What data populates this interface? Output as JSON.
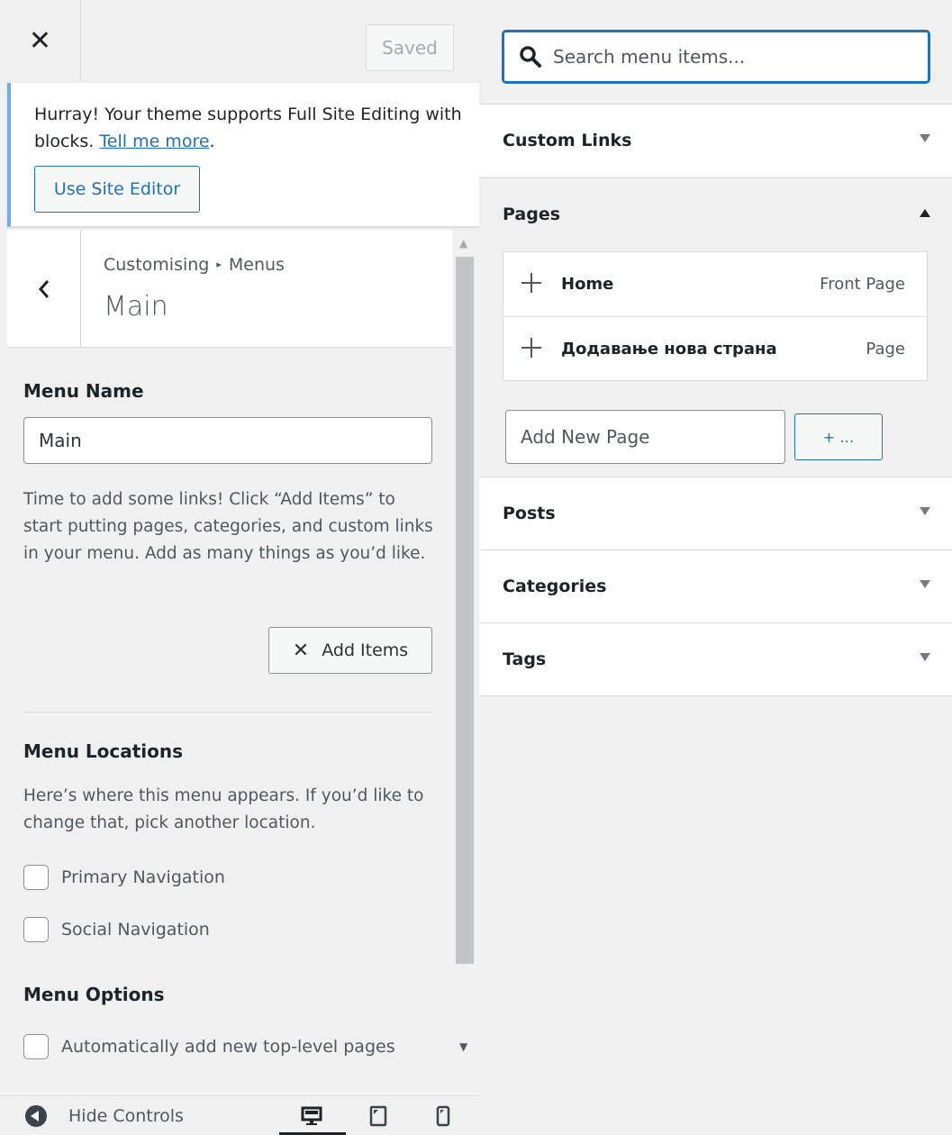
{
  "header": {
    "close_label": "✕",
    "saved_label": "Saved"
  },
  "notice": {
    "text_before": "Hurray! Your theme supports Full Site Editing with blocks.",
    "link_text": "Tell me more",
    "text_after": ".",
    "button_label": "Use Site Editor"
  },
  "section": {
    "breadcrumb_root": "Customising",
    "breadcrumb_separator": "▸",
    "breadcrumb_current": "Menus",
    "title": "Main"
  },
  "menu": {
    "name_label": "Menu Name",
    "name_value": "Main",
    "help_text": "Time to add some links! Click “Add Items” to start putting pages, categories, and custom links in your menu. Add as many things as you’d like.",
    "add_items_label": "Add Items",
    "locations_label": "Menu Locations",
    "locations_desc": "Here’s where this menu appears. If you’d like to change that, pick another location.",
    "locations": [
      {
        "label": "Primary Navigation",
        "checked": false
      },
      {
        "label": "Social Navigation",
        "checked": false
      }
    ],
    "options_label": "Menu Options",
    "options": [
      {
        "label": "Automatically add new top-level pages",
        "checked": false
      }
    ]
  },
  "footer": {
    "hide_controls_label": "Hide Controls",
    "active_device": "desktop",
    "devices": [
      "desktop",
      "tablet",
      "mobile"
    ]
  },
  "items_panel": {
    "search_placeholder": "Search menu items...",
    "sections": [
      {
        "title": "Custom Links",
        "expanded": false
      },
      {
        "title": "Pages",
        "expanded": true
      },
      {
        "title": "Posts",
        "expanded": false
      },
      {
        "title": "Categories",
        "expanded": false
      },
      {
        "title": "Tags",
        "expanded": false
      }
    ],
    "pages": [
      {
        "title": "Home",
        "type": "Front Page"
      },
      {
        "title": "Додавање нова страна",
        "type": "Page"
      }
    ],
    "new_page_placeholder": "Add New Page",
    "new_page_button": "+ …"
  },
  "colors": {
    "accent": "#2271b1",
    "notice_border": "#72aee6",
    "panel_bg": "#f0f0f1"
  }
}
